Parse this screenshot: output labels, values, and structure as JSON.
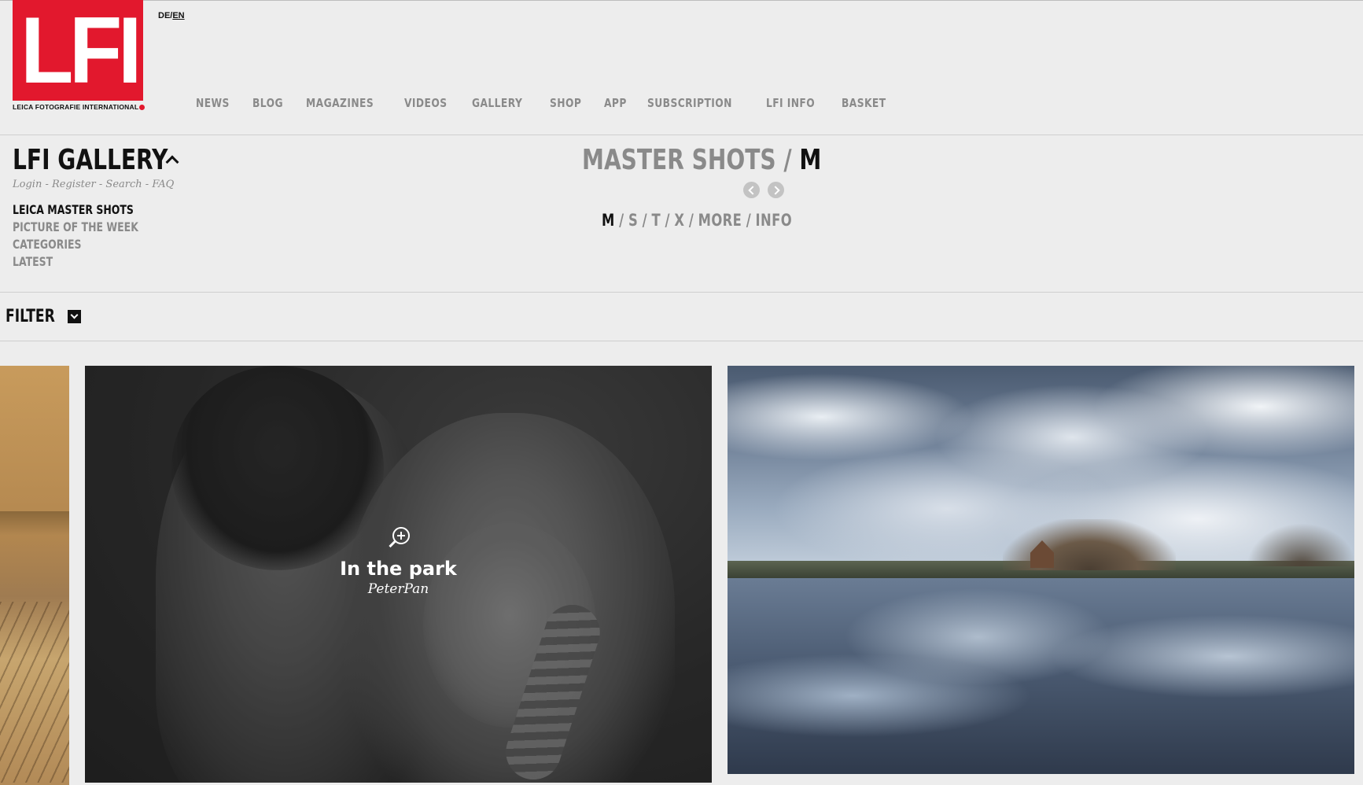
{
  "header": {
    "logo_text": "LFI",
    "logo_subtitle": "LEICA FOTOGRAFIE INTERNATIONAL",
    "lang": {
      "de": "DE",
      "sep": "/",
      "en": "EN"
    },
    "nav": [
      "NEWS",
      "BLOG",
      "MAGAZINES",
      "VIDEOS",
      "GALLERY",
      "SHOP",
      "APP",
      "SUBSCRIPTION",
      "LFI INFO",
      "BASKET"
    ]
  },
  "gallery": {
    "title": "LFI GALLERY",
    "user_links": {
      "login": "Login",
      "register": "Register",
      "search": "Search",
      "faq": "FAQ",
      "sep": " - "
    },
    "subnav": [
      "LEICA MASTER SHOTS",
      "PICTURE OF THE WEEK",
      "CATEGORIES",
      "LATEST"
    ]
  },
  "master_shots": {
    "title_prefix": "MASTER SHOTS / ",
    "title_current": "M",
    "models": [
      "M",
      "S",
      "T",
      "X",
      "MORE",
      "INFO"
    ]
  },
  "filter": {
    "label": "FILTER"
  },
  "photos": [
    {
      "title": "In the park",
      "author": "PeterPan"
    }
  ],
  "colors": {
    "brand_red": "#e2182d",
    "text_dark": "#111111",
    "text_grey": "#8a8a8a",
    "background": "#ededed"
  }
}
